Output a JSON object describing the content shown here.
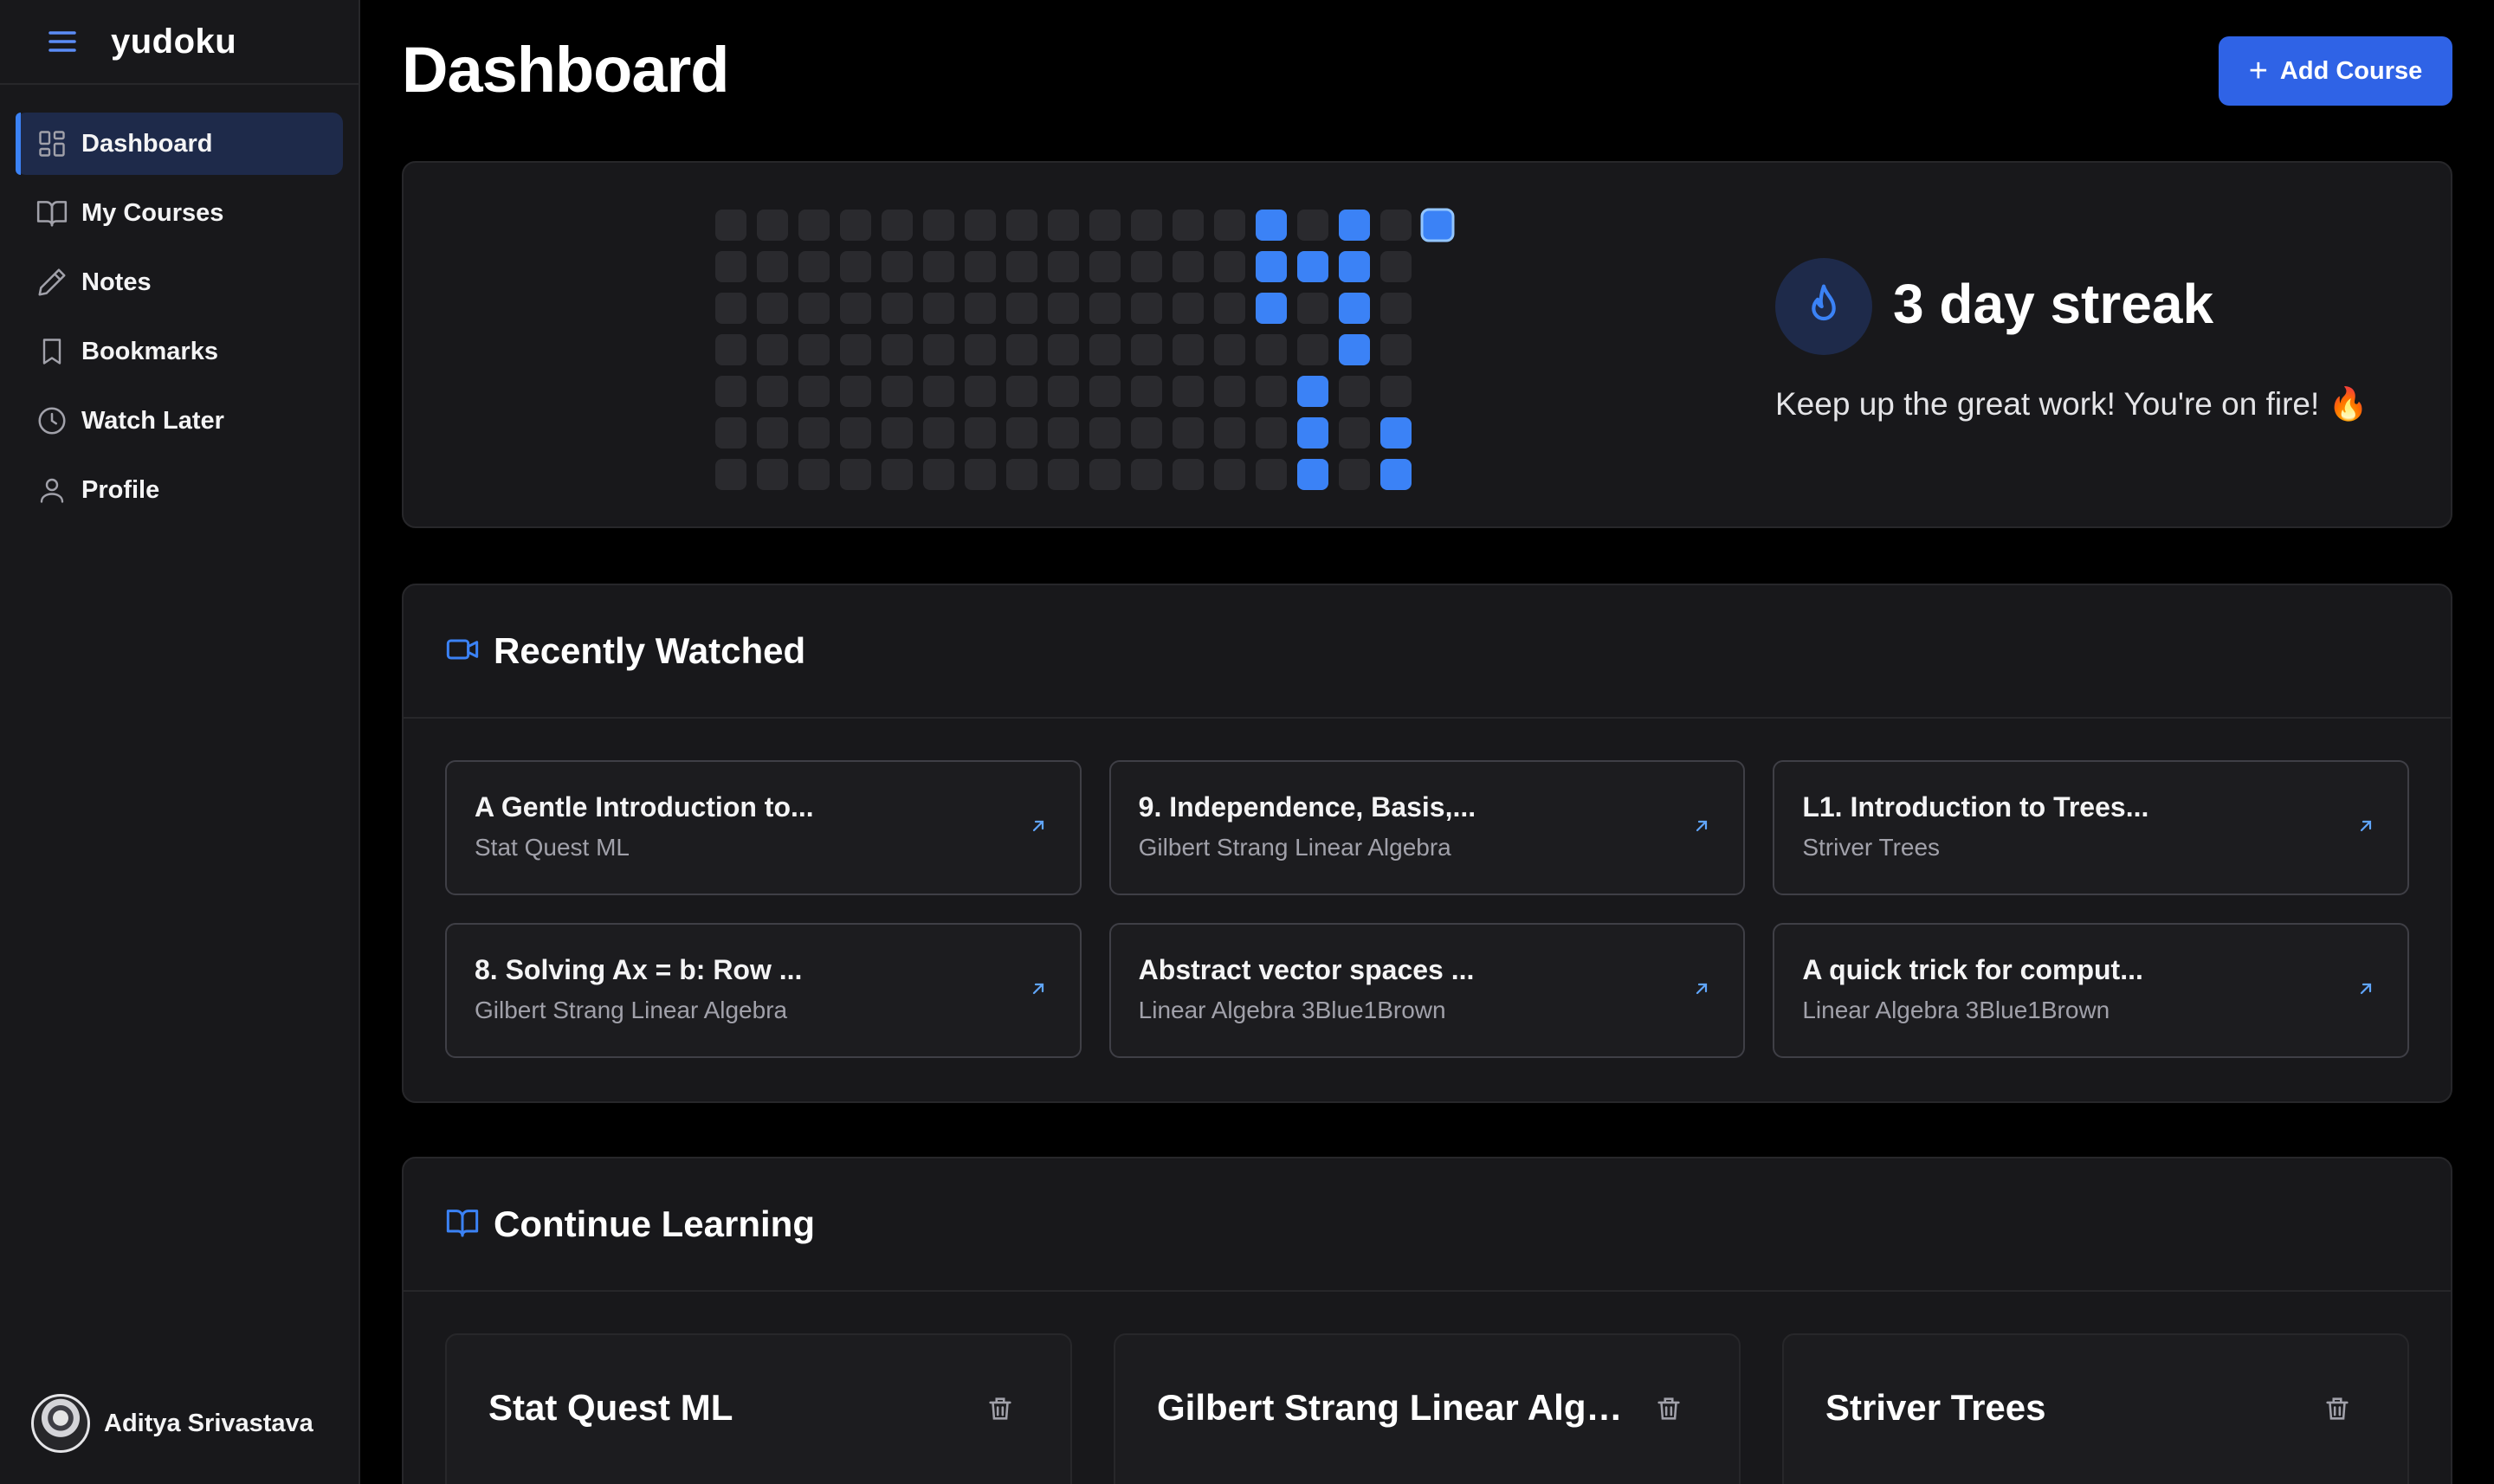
{
  "app": {
    "name": "yudoku"
  },
  "sidebar": {
    "items": [
      {
        "label": "Dashboard",
        "icon": "dashboard-icon",
        "active": true
      },
      {
        "label": "My Courses",
        "icon": "book-open-icon"
      },
      {
        "label": "Notes",
        "icon": "pencil-icon"
      },
      {
        "label": "Bookmarks",
        "icon": "bookmark-icon"
      },
      {
        "label": "Watch Later",
        "icon": "clock-icon"
      },
      {
        "label": "Profile",
        "icon": "user-icon"
      }
    ],
    "user": {
      "name": "Aditya Srivastava"
    }
  },
  "header": {
    "title": "Dashboard",
    "add_label": "Add Course"
  },
  "streak": {
    "title": "3 day streak",
    "subtitle": "Keep up the great work! You're on fire! 🔥",
    "active_cells": [
      [
        13,
        0
      ],
      [
        13,
        1
      ],
      [
        13,
        2
      ],
      [
        14,
        1
      ],
      [
        14,
        4
      ],
      [
        14,
        5
      ],
      [
        14,
        6
      ],
      [
        15,
        0
      ],
      [
        15,
        1
      ],
      [
        15,
        2
      ],
      [
        15,
        3
      ],
      [
        16,
        5
      ],
      [
        16,
        6
      ],
      [
        17,
        0
      ]
    ],
    "highlight_cell": [
      17,
      0
    ],
    "columns": 18,
    "rows": 7,
    "colors": {
      "active": "#3b82f6",
      "empty": "#2a2a2e"
    }
  },
  "recent": {
    "title": "Recently Watched",
    "items": [
      {
        "title": "A Gentle Introduction to...",
        "subtitle": "Stat Quest ML"
      },
      {
        "title": "9. Independence, Basis,...",
        "subtitle": "Gilbert Strang Linear Algebra"
      },
      {
        "title": "L1. Introduction to Trees...",
        "subtitle": "Striver Trees"
      },
      {
        "title": "8. Solving Ax = b: Row ...",
        "subtitle": "Gilbert Strang Linear Algebra"
      },
      {
        "title": "Abstract vector spaces ...",
        "subtitle": "Linear Algebra 3Blue1Brown"
      },
      {
        "title": "A quick trick for comput...",
        "subtitle": "Linear Algebra 3Blue1Brown"
      }
    ]
  },
  "continue": {
    "title": "Continue Learning",
    "courses": [
      {
        "title": "Stat Quest ML"
      },
      {
        "title": "Gilbert Strang Linear Algebra"
      },
      {
        "title": "Striver Trees"
      }
    ]
  },
  "colors": {
    "accent": "#3b82f6",
    "button": "#2f63e6"
  }
}
